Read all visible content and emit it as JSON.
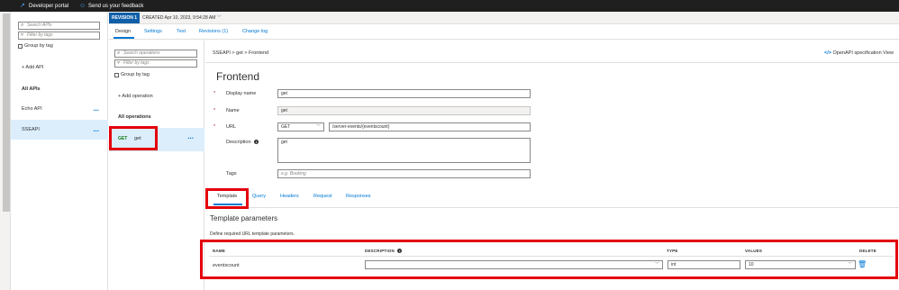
{
  "topbar": {
    "developer_portal": "Developer portal",
    "feedback": "Send us your feedback"
  },
  "api_panel": {
    "search_placeholder": "Search APIs",
    "filter_placeholder": "Filter by tags",
    "group_by_tag": "Group by tag",
    "add_api": "+ Add API",
    "section_title": "All APIs",
    "apis": [
      {
        "name": "Echo API",
        "selected": false
      },
      {
        "name": "SSEAPI",
        "selected": true
      }
    ],
    "more": "..."
  },
  "revision": {
    "badge": "REVISION 1",
    "created": "CREATED Apr 10, 2023, 9:54:28 AM"
  },
  "tabs": [
    {
      "label": "Design",
      "active": true
    },
    {
      "label": "Settings",
      "active": false
    },
    {
      "label": "Test",
      "active": false
    },
    {
      "label": "Revisions (1)",
      "active": false
    },
    {
      "label": "Change log",
      "active": false
    }
  ],
  "ops_panel": {
    "search_placeholder": "Search operations",
    "filter_placeholder": "Filter by tags",
    "group_by_tag": "Group by tag",
    "add_operation": "+ Add operation",
    "section_title": "All operations",
    "operation": {
      "method": "GET",
      "name": "get"
    },
    "more": "..."
  },
  "main": {
    "breadcrumb": "SSEAPI > get > Frontend",
    "openapi_link": "OpenAPI specification View",
    "openapi_icon": "</>",
    "title": "Frontend",
    "form": {
      "display_name_label": "Display name",
      "display_name_value": "get",
      "name_label": "Name",
      "name_value": "get",
      "url_label": "URL",
      "url_method": "GET",
      "url_path": "/server-events/{eventscount}",
      "description_label": "Description",
      "description_value": "get",
      "tags_label": "Tags",
      "tags_placeholder": "e.g. Booking",
      "required_mark": "*"
    },
    "subtabs": [
      {
        "label": "Template",
        "active": true
      },
      {
        "label": "Query",
        "active": false
      },
      {
        "label": "Headers",
        "active": false
      },
      {
        "label": "Request",
        "active": false
      },
      {
        "label": "Responses",
        "active": false
      }
    ],
    "template_params": {
      "title": "Template parameters",
      "description": "Define required URL template parameters.",
      "headers": {
        "name": "NAME",
        "description": "DESCRIPTION",
        "type": "TYPE",
        "values": "VALUES",
        "delete": "DELETE"
      },
      "rows": [
        {
          "name": "eventscount",
          "description": "",
          "type": "int",
          "values": "10"
        }
      ]
    }
  },
  "colors": {
    "accent": "#0078d4",
    "highlight": "#e3000b",
    "get_method": "#107c10",
    "selected_bg": "#dceefc"
  }
}
